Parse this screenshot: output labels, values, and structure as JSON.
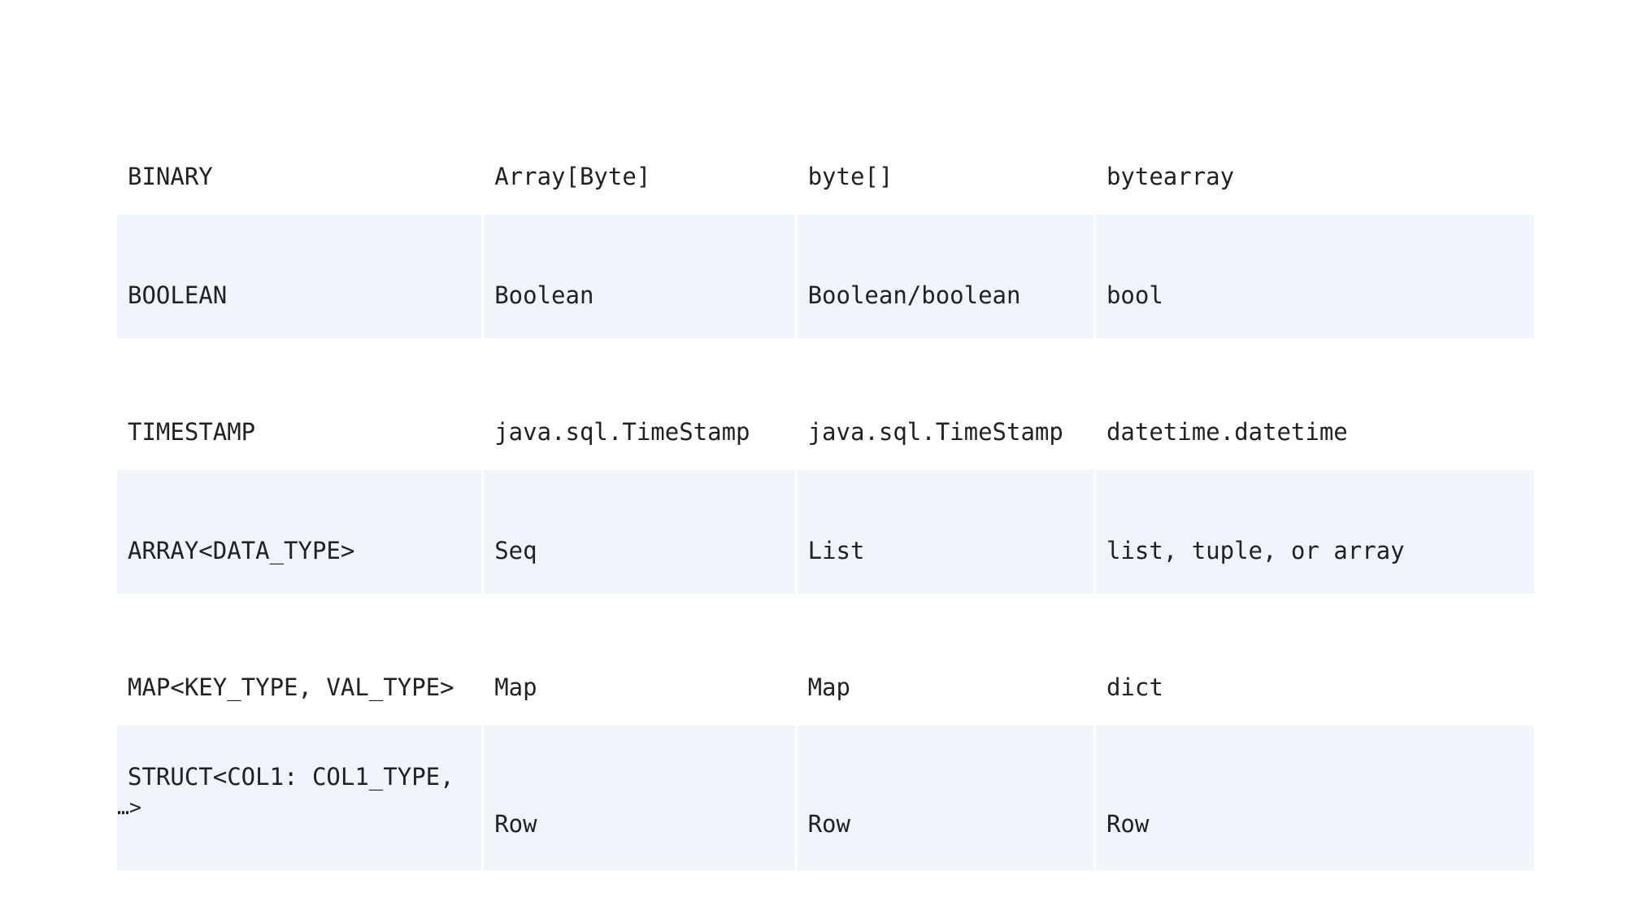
{
  "table": {
    "rows": [
      {
        "sql": "BINARY",
        "scala": "Array[Byte]",
        "java": "byte[]",
        "python": "bytearray"
      },
      {
        "sql": "BOOLEAN",
        "scala": "Boolean",
        "java": "Boolean/boolean",
        "python": "bool"
      },
      {
        "sql": "TIMESTAMP",
        "scala": "java.sql.TimeStamp",
        "java": "java.sql.TimeStamp",
        "python": "datetime.datetime"
      },
      {
        "sql": "ARRAY<DATA_TYPE>",
        "scala": "Seq",
        "java": "List",
        "python": "list, tuple, or array"
      },
      {
        "sql": "MAP<KEY_TYPE, VAL_TYPE>",
        "scala": "Map",
        "java": "Map",
        "python": "dict"
      },
      {
        "sql": "STRUCT<COL1: COL1_TYPE,",
        "sql_cont": "…>",
        "scala": "Row",
        "java": "Row",
        "python": "Row"
      }
    ],
    "shaded_row_color": "#f0f5fc",
    "text_color": "#222222"
  }
}
